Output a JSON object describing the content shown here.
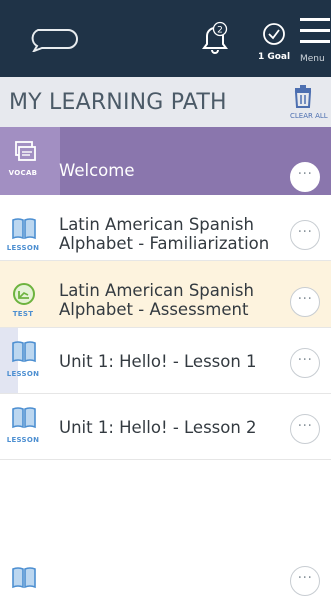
{
  "topbar": {
    "notification_count": "2",
    "goal_label": "1 Goal",
    "menu_label": "Menu"
  },
  "header": {
    "title": "MY LEARNING PATH",
    "clear_label": "CLEAR ALL"
  },
  "colors": {
    "topbar": "#1f3347",
    "welcome_bg": "#8a76ad",
    "welcome_stripe": "#a28fc2",
    "test_bg": "#fdf3de",
    "lesson_blue": "#4d8fd1",
    "test_green": "#6db33f"
  },
  "items": [
    {
      "type": "VOCAB",
      "icon": "flashcards-icon",
      "title": "Welcome",
      "state": "current",
      "more": "···"
    },
    {
      "type": "LESSON",
      "icon": "book-icon",
      "title": "Latin American Spanish Alphabet - Familiarization",
      "state": "normal",
      "more": "···"
    },
    {
      "type": "TEST",
      "icon": "test-icon",
      "title": "Latin American Spanish Alphabet - Assessment",
      "state": "test",
      "more": "···"
    },
    {
      "type": "LESSON",
      "icon": "book-icon",
      "title": "Unit 1: Hello! - Lesson 1",
      "state": "active",
      "more": "···"
    },
    {
      "type": "LESSON",
      "icon": "book-icon",
      "title": "Unit 1: Hello! - Lesson 2",
      "state": "normal",
      "more": "···"
    },
    {
      "type": "LESSON",
      "icon": "book-icon",
      "title": "",
      "state": "partial",
      "more": "···"
    }
  ]
}
